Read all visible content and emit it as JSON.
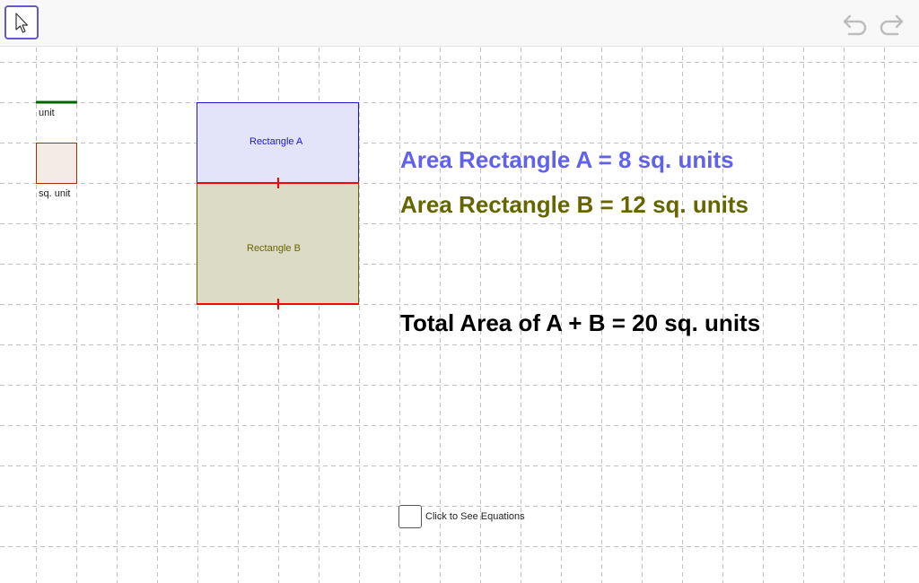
{
  "toolbar": {
    "move_tool_icon": "arrow-pointer-icon",
    "undo_icon": "undo-icon",
    "redo_icon": "redo-icon"
  },
  "canvas": {
    "unit_label": "unit",
    "square_unit_label": "sq. unit",
    "rectangle_a_label": "Rectangle A",
    "rectangle_b_label": "Rectangle B",
    "area_a_text": "Area Rectangle A = 8 sq. units",
    "area_b_text": "Area Rectangle B = 12 sq. units",
    "total_text": "Total Area of A + B = 20 sq. units",
    "equations_checkbox_label": "Click to See Equations",
    "equations_checked": false
  },
  "colors": {
    "rectangle_a_fill": "#e3e3fa",
    "rectangle_a_stroke": "#1a1acc",
    "rectangle_b_fill": "#dcdcc6",
    "rectangle_b_stroke": "#666600",
    "area_a_text": "#6161f0",
    "area_b_text": "#666600",
    "segment_red": "#ff0000",
    "unit_segment": "#006400",
    "square_unit_fill": "#f5ebe6",
    "square_unit_stroke": "#993300",
    "tool_highlight": "#6557d2"
  }
}
